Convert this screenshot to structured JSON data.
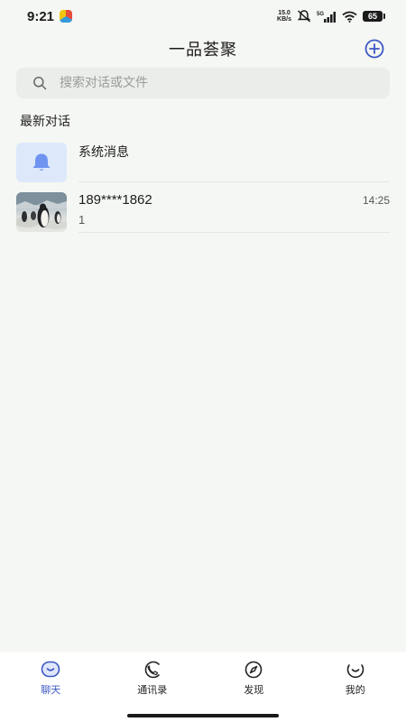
{
  "status_bar": {
    "time": "9:21",
    "net_speed_value": "15.0",
    "net_speed_unit": "KB/s",
    "network": "5G",
    "battery": "65"
  },
  "header": {
    "title": "一品荟聚",
    "add_icon": "plus-circle-icon"
  },
  "search": {
    "placeholder": "搜索对话或文件",
    "value": ""
  },
  "section_title": "最新对话",
  "conversations": [
    {
      "name": "系统消息",
      "preview": "",
      "time": "",
      "avatar": "bell-icon"
    },
    {
      "name": "189****1862",
      "preview": "1",
      "time": "14:25",
      "avatar": "penguin-photo"
    }
  ],
  "tabs": [
    {
      "label": "聊天",
      "icon": "chat-icon",
      "active": true
    },
    {
      "label": "通讯录",
      "icon": "contacts-icon",
      "active": false
    },
    {
      "label": "发现",
      "icon": "compass-icon",
      "active": false
    },
    {
      "label": "我的",
      "icon": "profile-icon",
      "active": false
    }
  ],
  "colors": {
    "accent": "#3b57c4",
    "background": "#f5f7f4",
    "search_bg": "#ebedea",
    "system_avatar_bg": "#dde8fb"
  }
}
